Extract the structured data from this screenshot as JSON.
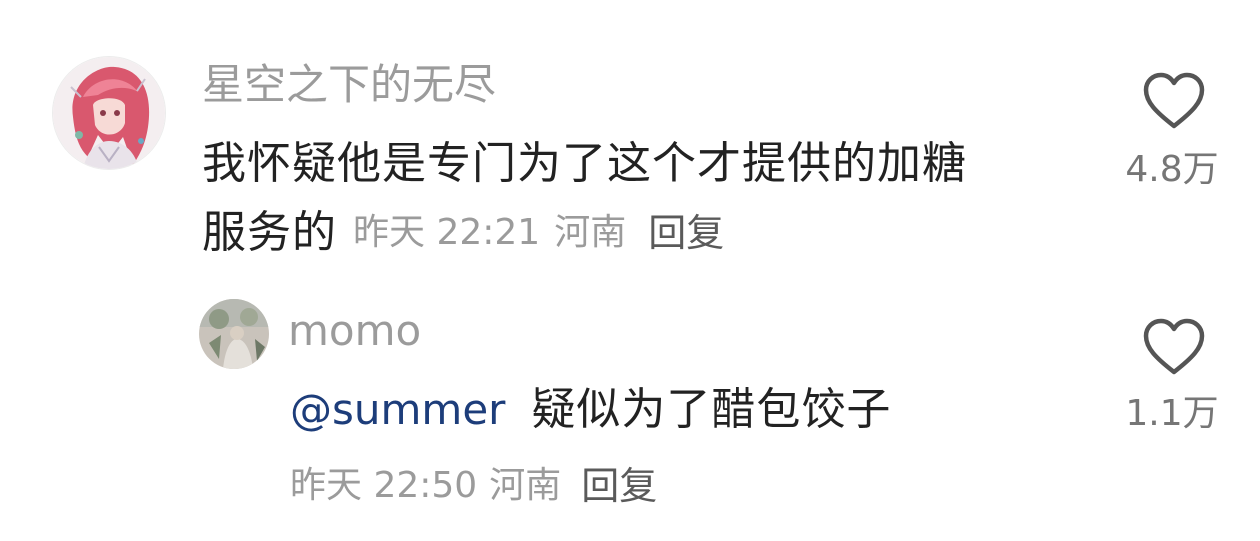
{
  "comment": {
    "username": "星空之下的无尽",
    "text_line1": "我怀疑他是专门为了这个才提供的加糖",
    "text_line2": "服务的",
    "time": "昨天 22:21",
    "location": "河南",
    "reply_label": "回复",
    "like_count": "4.8万",
    "avatar_icon": "anime-character-avatar-icon"
  },
  "reply": {
    "username": "momo",
    "mention": "@summer",
    "text": "疑似为了醋包饺子",
    "time": "昨天 22:50",
    "location": "河南",
    "reply_label": "回复",
    "like_count": "1.1万",
    "avatar_icon": "photo-avatar-icon"
  },
  "colors": {
    "username": "#9b9b9b",
    "text": "#222222",
    "mention": "#1d3d7a",
    "meta": "#9b9b9b",
    "heart_stroke": "#555555"
  }
}
